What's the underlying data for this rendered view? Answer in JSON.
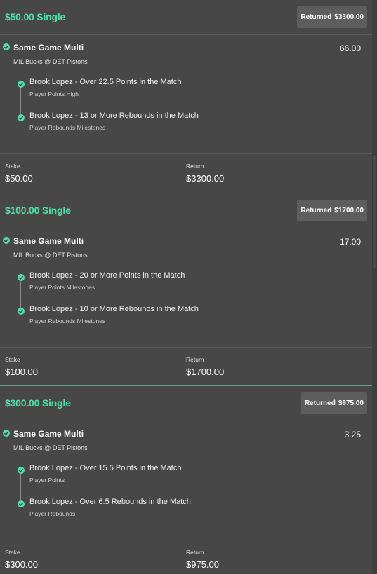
{
  "bets": [
    {
      "title": "$50.00 Single",
      "returned_label": "Returned",
      "returned_amount": "$3300.00",
      "multi_title": "Same Game Multi",
      "odds": "66.00",
      "match": "MIL Bucks @ DET Pistons",
      "legs": [
        {
          "title": "Brook Lopez - Over 22.5 Points in the Match",
          "market": "Player Points High"
        },
        {
          "title": "Brook Lopez - 13 or More Rebounds in the Match",
          "market": "Player Rebounds Milestones"
        }
      ],
      "stake_label": "Stake",
      "stake": "$50.00",
      "return_label": "Return",
      "return": "$3300.00"
    },
    {
      "title": "$100.00 Single",
      "returned_label": "Returned",
      "returned_amount": "$1700.00",
      "multi_title": "Same Game Multi",
      "odds": "17.00",
      "match": "MIL Bucks @ DET Pistons",
      "legs": [
        {
          "title": "Brook Lopez - 20 or More Points in the Match",
          "market": "Player Points Milestones"
        },
        {
          "title": "Brook Lopez - 10 or More Rebounds in the Match",
          "market": "Player Rebounds Milestones"
        }
      ],
      "stake_label": "Stake",
      "stake": "$100.00",
      "return_label": "Return",
      "return": "$1700.00"
    },
    {
      "title": "$300.00 Single",
      "returned_label": "Returned",
      "returned_amount": "$975.00",
      "multi_title": "Same Game Multi",
      "odds": "3.25",
      "match": "MIL Bucks @ DET Pistons",
      "legs": [
        {
          "title": "Brook Lopez - Over 15.5 Points in the Match",
          "market": "Player Points"
        },
        {
          "title": "Brook Lopez - Over 6.5 Rebounds in the Match",
          "market": "Player Rebounds"
        }
      ],
      "stake_label": "Stake",
      "stake": "$300.00",
      "return_label": "Return",
      "return": "$975.00"
    }
  ],
  "colors": {
    "accent": "#4fdfab",
    "background": "#474747",
    "badge": "#5d5d5d",
    "divider": "#5d9e8e"
  },
  "icons": {
    "tick": "check-circle-icon"
  }
}
